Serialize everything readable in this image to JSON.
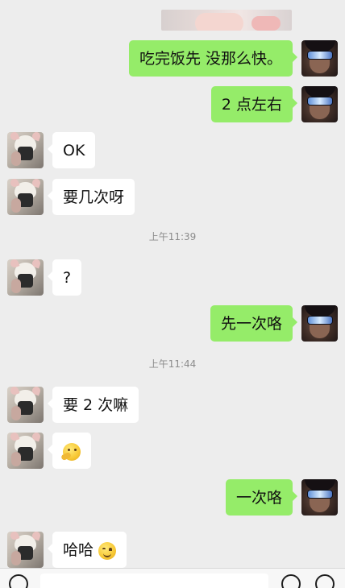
{
  "chat": {
    "messages": [
      {
        "side": "right",
        "text": "吃完饭先 没那么快。"
      },
      {
        "side": "right",
        "text": "2 点左右"
      },
      {
        "side": "left",
        "text": "OK"
      },
      {
        "side": "left",
        "text": "要几次呀"
      },
      {
        "side": "left",
        "text": "?"
      },
      {
        "side": "right",
        "text": "先一次咯"
      },
      {
        "side": "left",
        "text": "要 2 次嘛"
      },
      {
        "side": "left",
        "text": "",
        "emoji": "thinking-face-emoji"
      },
      {
        "side": "right",
        "text": "一次咯"
      },
      {
        "side": "left",
        "text": "哈哈",
        "emoji": "smiling-face-emoji"
      }
    ],
    "timestamps": [
      "上午11:39",
      "上午11:44"
    ]
  },
  "colors": {
    "background": "#ededed",
    "outgoing_bubble": "#95ec69",
    "incoming_bubble": "#ffffff",
    "timestamp_text": "#8c8c8c"
  },
  "icons": {
    "voice": "voice-icon",
    "emoji": "emoji-icon",
    "plus": "plus-icon"
  }
}
